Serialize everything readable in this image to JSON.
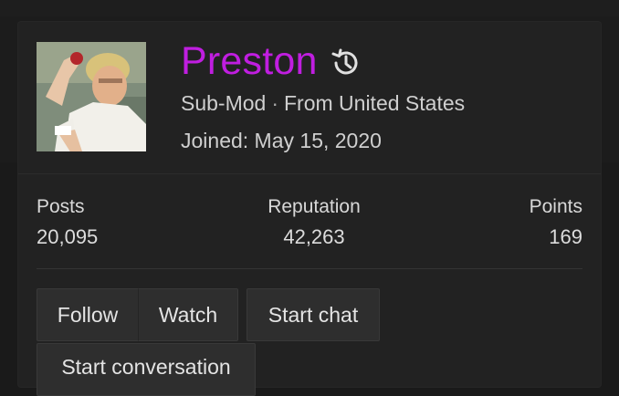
{
  "profile": {
    "username": "Preston",
    "role": "Sub-Mod",
    "separator": "·",
    "location": "From United States",
    "joined": "Joined: May 15, 2020",
    "username_color": "#c01ee0"
  },
  "stats": [
    {
      "label": "Posts",
      "value": "20,095"
    },
    {
      "label": "Reputation",
      "value": "42,263"
    },
    {
      "label": "Points",
      "value": "169"
    }
  ],
  "actions": {
    "follow": "Follow",
    "watch": "Watch",
    "start_chat": "Start chat",
    "start_conversation": "Start conversation"
  },
  "icons": {
    "history": "history-icon",
    "avatar": "avatar-image"
  }
}
